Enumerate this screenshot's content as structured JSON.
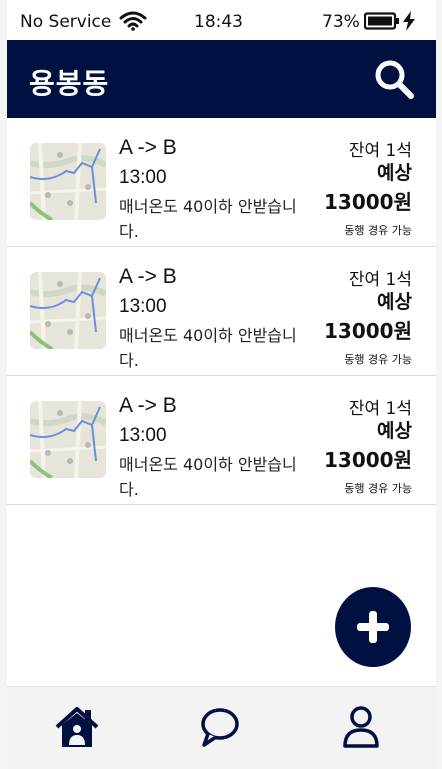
{
  "status_bar": {
    "carrier": "No Service",
    "time": "18:43",
    "battery_percent": "73%",
    "battery_level": 0.73,
    "icons": [
      "wifi-icon",
      "battery-icon",
      "charging-bolt-icon"
    ]
  },
  "app_bar": {
    "title": "용봉동",
    "search_icon": "search-icon"
  },
  "listings": [
    {
      "route": "A -> B",
      "time": "13:00",
      "description": "매너온도 40이하 안받습니다.",
      "seats": "잔여 1석",
      "expected_label": "예상",
      "price": "13000원",
      "via": "동행 경유 가능"
    },
    {
      "route": "A -> B",
      "time": "13:00",
      "description": "매너온도 40이하 안받습니다.",
      "seats": "잔여 1석",
      "expected_label": "예상",
      "price": "13000원",
      "via": "동행 경유 가능"
    },
    {
      "route": "A -> B",
      "time": "13:00",
      "description": "매너온도 40이하 안받습니다.",
      "seats": "잔여 1석",
      "expected_label": "예상",
      "price": "13000원",
      "via": "동행 경유 가능"
    }
  ],
  "fab": {
    "icon": "plus-icon"
  },
  "bottom_nav": {
    "items": [
      "home-icon",
      "chat-icon",
      "profile-icon"
    ]
  },
  "colors": {
    "primary": "#001040",
    "background": "#ffffff",
    "nav_background": "#f3f3f3"
  }
}
